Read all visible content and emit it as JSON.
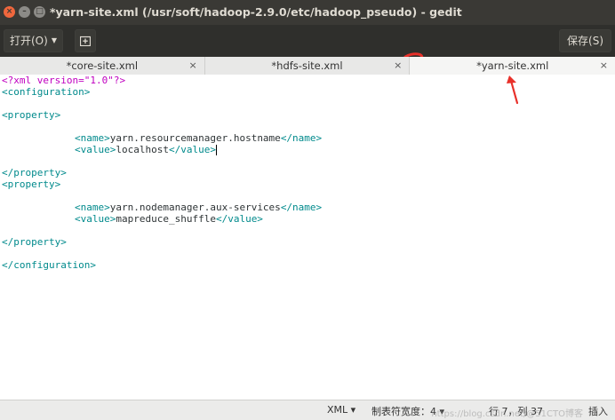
{
  "window": {
    "title": "*yarn-site.xml (/usr/soft/hadoop-2.9.0/etc/hadoop_pseudo) - gedit"
  },
  "header": {
    "open_label": "打开(O)",
    "save_label": "保存(S)",
    "annotation": "3"
  },
  "tabs": [
    {
      "label": "*core-site.xml",
      "close": "×"
    },
    {
      "label": "*hdfs-site.xml",
      "close": "×"
    },
    {
      "label": "*yarn-site.xml",
      "close": "×"
    }
  ],
  "editor": {
    "xml_decl": "<?xml version=\"1.0\"?>",
    "configuration_open": "<configuration>",
    "property_open": "<property>",
    "property_close": "</property>",
    "configuration_close": "</configuration>",
    "properties": [
      {
        "name": "yarn.resourcemanager.hostname",
        "value": "localhost"
      },
      {
        "name": "yarn.nodemanager.aux-services",
        "value": "mapreduce_shuffle"
      }
    ]
  },
  "status": {
    "language": "XML",
    "tab_width": "制表符宽度：4",
    "cursor_position": "行 7，列 37",
    "insert_mode": "插入",
    "watermark": "https://blog.csdn.net/@51CTO博客"
  },
  "colors": {
    "tag": "#008a8c",
    "declaration": "#c000c0",
    "annotation": "#e8302a"
  }
}
